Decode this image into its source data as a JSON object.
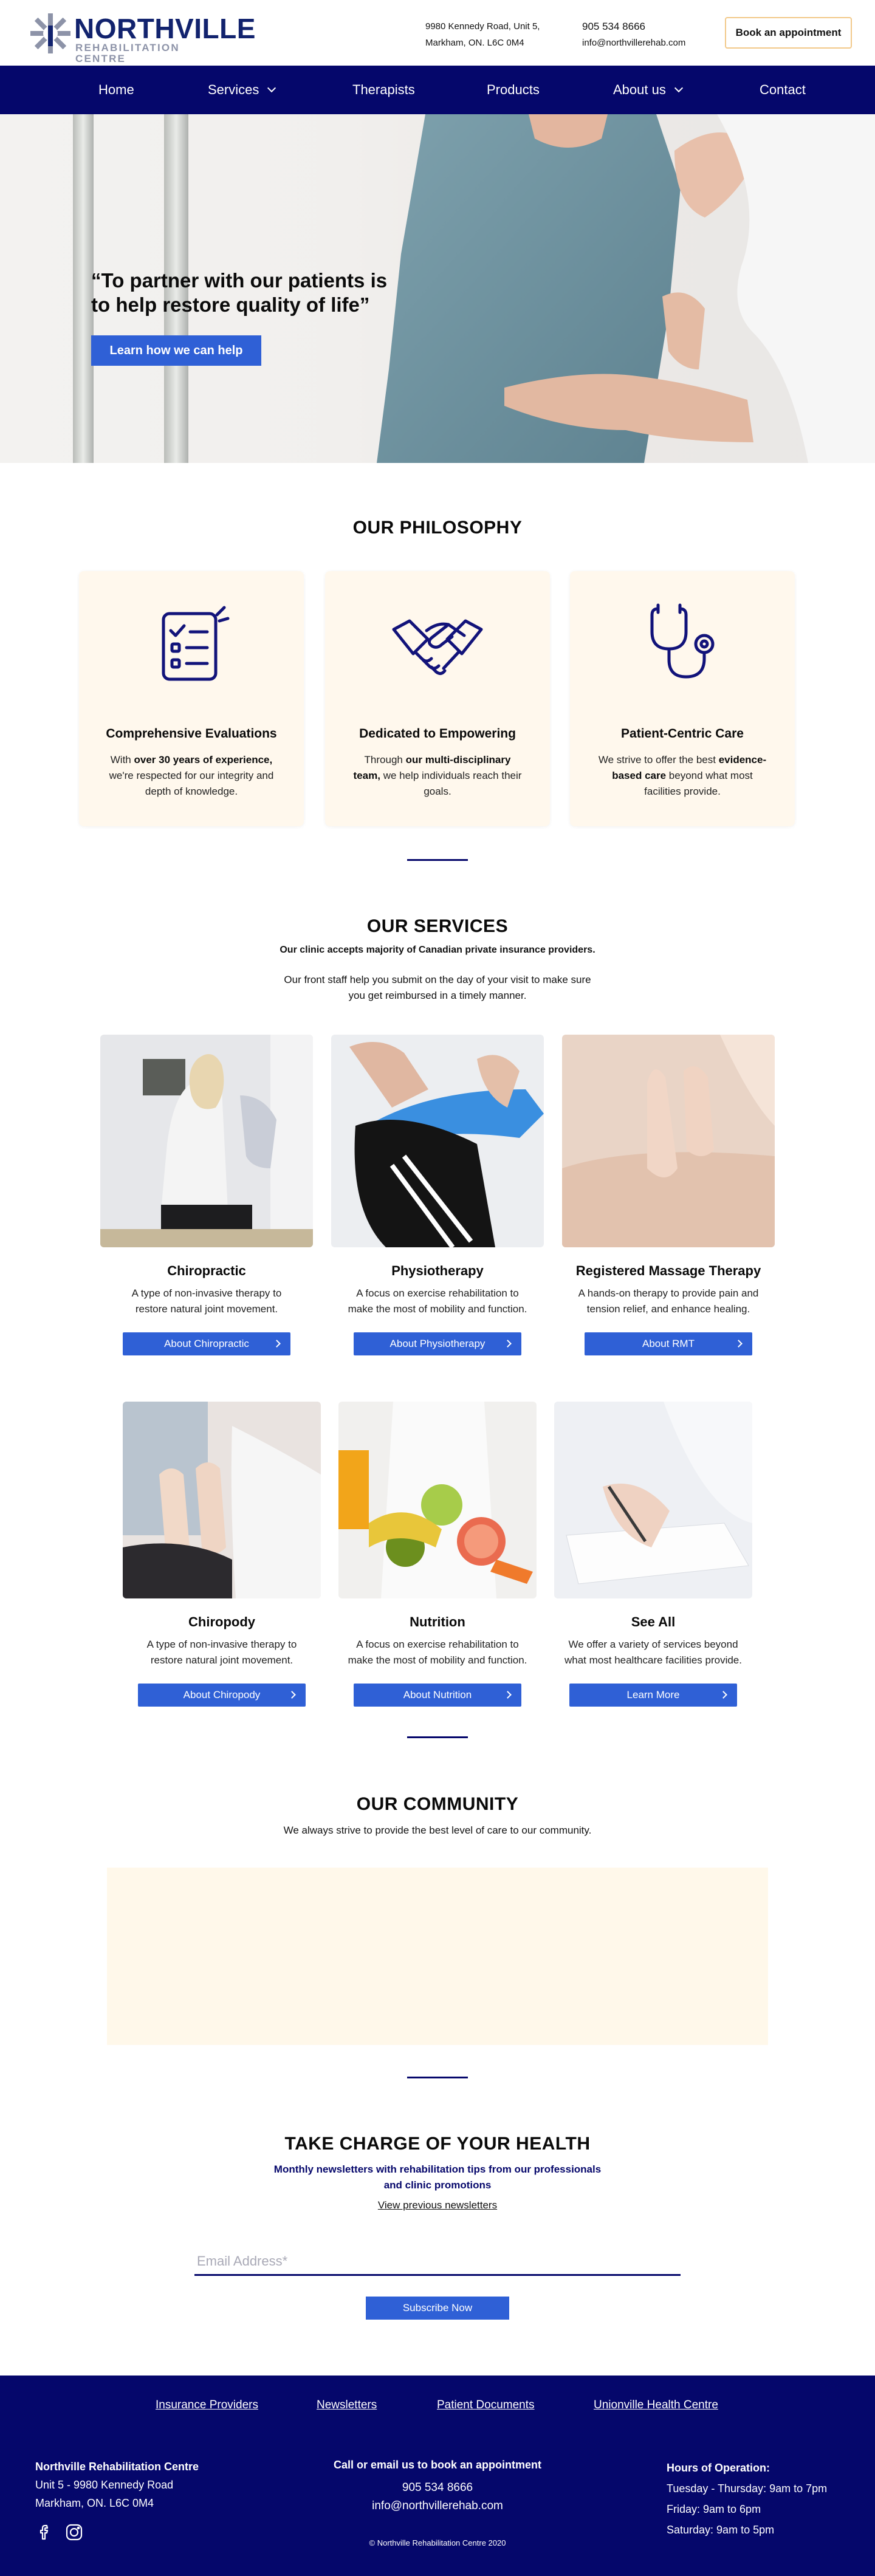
{
  "header": {
    "logo_name": "NORTHVILLE",
    "logo_sub": "REHABILITATION CENTRE",
    "address_line1": "9980 Kennedy Road, Unit 5,",
    "address_line2": "Markham, ON.   L6C 0M4",
    "phone": "905 534 8666",
    "email": "info@northvillerehab.com",
    "book_label": "Book an appointment"
  },
  "nav": {
    "home": "Home",
    "services": "Services",
    "therapists": "Therapists",
    "products": "Products",
    "about": "About us",
    "contact": "Contact"
  },
  "hero": {
    "quote": "“To partner with our patients is to help restore quality of life”",
    "cta": "Learn how we can help"
  },
  "philosophy": {
    "title": "OUR PHILOSOPHY",
    "cards": [
      {
        "icon": "checklist-icon",
        "title": "Comprehensive Evaluations"
      },
      {
        "icon": "handshake-icon",
        "title": "Dedicated to Empowering"
      },
      {
        "icon": "stethoscope-icon",
        "title": "Patient-Centric Care"
      }
    ],
    "card1_pre": "With ",
    "card1_bold": "over 30 years of experience,",
    "card1_post": " we're respected for our integrity and depth of knowledge.",
    "card2_pre": "Through ",
    "card2_bold": "our multi-disciplinary team,",
    "card2_post": " we help  individuals reach their goals.",
    "card3_pre": "We strive to offer the best ",
    "card3_bold": "evidence-based care",
    "card3_post": " beyond what most facilities provide."
  },
  "services": {
    "title": "OUR SERVICES",
    "insurance_note": "Our clinic accepts majority of Canadian private insurance providers.",
    "staff_note_1": "Our front staff help you submit on the day of your visit to make sure",
    "staff_note_2": "you get reimbursed in a timely manner.",
    "items": [
      {
        "title": "Chiropractic",
        "desc1": "A type of non-invasive therapy to",
        "desc2": "restore natural joint movement.",
        "button": "About Chiropractic"
      },
      {
        "title": "Physiotherapy",
        "desc1": "A focus on exercise rehabilitation to",
        "desc2": "make the most of mobility and function.",
        "button": "About Physiotherapy"
      },
      {
        "title": "Registered Massage Therapy",
        "desc1": "A hands-on therapy to provide pain and",
        "desc2": "tension relief, and enhance healing.",
        "button": "About RMT"
      },
      {
        "title": "Chiropody",
        "desc1": "A type of non-invasive therapy to",
        "desc2": "restore natural joint movement.",
        "button": "About Chiropody"
      },
      {
        "title": "Nutrition",
        "desc1": "A focus on exercise rehabilitation to",
        "desc2": "make the most of mobility and function.",
        "button": "About Nutrition"
      },
      {
        "title": "See All",
        "desc1": "We offer a variety of services beyond",
        "desc2": "what most healthcare facilities provide.",
        "button": "Learn More"
      }
    ]
  },
  "community": {
    "title": "OUR COMMUNITY",
    "subtitle": "We always strive to provide the best level of care to our community."
  },
  "newsletter": {
    "title": "TAKE CHARGE OF YOUR HEALTH",
    "sub1": "Monthly newsletters with rehabilitation tips from our professionals",
    "sub2": "and clinic promotions",
    "link": "View previous newsletters",
    "email_placeholder": "Email Address*",
    "button": "Subscribe Now"
  },
  "footer": {
    "links": [
      "Insurance Providers",
      "Newsletters",
      "Patient Documents",
      "Unionville Health Centre"
    ],
    "clinic_name": "Northville Rehabilitation Centre",
    "addr1": "Unit 5 - 9980 Kennedy Road",
    "addr2": "Markham, ON. L6C 0M4",
    "call_title": "Call or email us to book an appointment",
    "phone": "905 534 8666",
    "email": "info@northvillerehab.com",
    "copyright": "© Northville Rehabilitation Centre 2020",
    "hours_title": "Hours of Operation:",
    "hours": [
      "Tuesday - Thursday: 9am to 7pm",
      "Friday: 9am to 6pm",
      "Saturday: 9am to 5pm"
    ]
  }
}
